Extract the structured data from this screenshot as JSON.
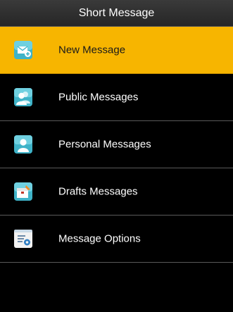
{
  "title": "Short Message",
  "colors": {
    "highlight": "#f7b500",
    "background": "#000000",
    "divider": "#5a5a5a"
  },
  "menu": {
    "items": [
      {
        "label": "New Message",
        "icon": "new-message-icon",
        "selected": true
      },
      {
        "label": "Public Messages",
        "icon": "public-messages-icon",
        "selected": false
      },
      {
        "label": "Personal Messages",
        "icon": "personal-messages-icon",
        "selected": false
      },
      {
        "label": "Drafts Messages",
        "icon": "drafts-messages-icon",
        "selected": false
      },
      {
        "label": "Message Options",
        "icon": "message-options-icon",
        "selected": false
      }
    ]
  }
}
